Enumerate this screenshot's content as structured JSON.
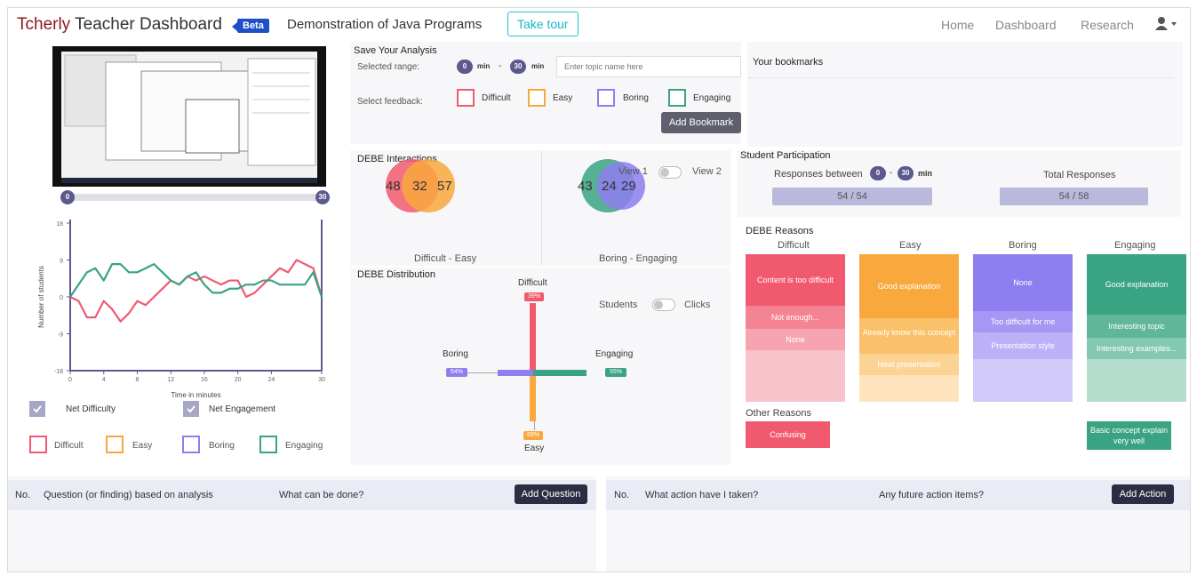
{
  "nav": {
    "brand_first": "Tcherly",
    "brand_rest": " Teacher Dashboard",
    "beta": "Beta",
    "session_title": "Demonstration of Java Programs",
    "tour": "Take tour",
    "links": [
      "Home",
      "Dashboard",
      "Research"
    ]
  },
  "video": {
    "range_start": "0",
    "range_end": "30"
  },
  "line_chart": {
    "ylabel": "Number of students",
    "xlabel": "Time in minutes",
    "y_ticks": [
      "18",
      "9",
      "0",
      "-9",
      "-18"
    ],
    "x_ticks": [
      "0",
      "4",
      "8",
      "12",
      "16",
      "20",
      "24",
      "30"
    ],
    "legend": [
      "Net Difficulty",
      "Net Engagement"
    ],
    "feedback_keys": [
      "Difficult",
      "Easy",
      "Boring",
      "Engaging"
    ]
  },
  "chart_data": {
    "type": "line",
    "xlabel": "Time in minutes",
    "ylabel": "Number of students",
    "xlim": [
      0,
      30
    ],
    "ylim": [
      -18,
      18
    ],
    "x": [
      0,
      1,
      2,
      3,
      4,
      5,
      6,
      7,
      8,
      9,
      10,
      11,
      12,
      13,
      14,
      15,
      16,
      17,
      18,
      19,
      20,
      21,
      22,
      23,
      24,
      25,
      26,
      27,
      28,
      29,
      30
    ],
    "series": [
      {
        "name": "Net Difficulty",
        "values": [
          0,
          -1,
          -5,
          -5,
          -1,
          -3,
          -6,
          -4,
          -1,
          -2,
          0,
          2,
          4,
          3,
          5,
          4,
          5,
          4,
          3,
          4,
          4,
          0,
          1,
          3,
          5,
          7,
          6,
          9,
          8,
          7,
          0
        ]
      },
      {
        "name": "Net Engagement",
        "values": [
          0,
          3,
          6,
          7,
          4,
          8,
          8,
          6,
          6,
          7,
          8,
          6,
          4,
          3,
          5,
          6,
          3,
          1,
          1,
          2,
          2,
          3,
          3,
          4,
          4,
          3,
          3,
          3,
          3,
          6,
          0
        ]
      }
    ]
  },
  "save_analysis": {
    "title": "Save Your Analysis",
    "range_label": "Selected range:",
    "start": "0",
    "start_unit": "min",
    "dash": "-",
    "end": "30",
    "end_unit": "min",
    "topic_placeholder": "Enter topic name here",
    "feedback_label": "Select feedback:",
    "options": [
      "Difficult",
      "Easy",
      "Boring",
      "Engaging"
    ],
    "button": "Add Bookmark"
  },
  "bookmarks": {
    "title": "Your bookmarks"
  },
  "interactions": {
    "title": "DEBE Interactions",
    "left_values": [
      "48",
      "32",
      "57"
    ],
    "left_label": "Difficult - Easy",
    "right_values": [
      "43",
      "24",
      "29"
    ],
    "right_label": "Boring - Engaging",
    "view1": "View 1",
    "view2": "View 2"
  },
  "distribution": {
    "title": "DEBE Distribution",
    "difficult": "Difficult",
    "difficult_pct": "39%",
    "easy": "Easy",
    "easy_pct": "69%",
    "boring": "Boring",
    "boring_pct": "54%",
    "engaging": "Engaging",
    "engaging_pct": "55%",
    "toggle_left": "Students",
    "toggle_right": "Clicks"
  },
  "participation": {
    "title": "Student Participation",
    "between_label": "Responses between",
    "start": "0",
    "dash": "-",
    "end": "30",
    "unit": "min",
    "between_value": "54 / 54",
    "total_label": "Total Responses",
    "total_value": "54 / 58"
  },
  "reasons": {
    "title": "DEBE Reasons",
    "columns": [
      {
        "label": "Difficult",
        "items": [
          "Content is too difficult",
          "Not enough...",
          "None"
        ]
      },
      {
        "label": "Easy",
        "items": [
          "Good explanation",
          "Already know this concept",
          "Neat presentation"
        ]
      },
      {
        "label": "Boring",
        "items": [
          "None",
          "Too difficult for me",
          "Presentation style"
        ]
      },
      {
        "label": "Engaging",
        "items": [
          "Good explanation",
          "Interesting topic",
          "Interesting examples..."
        ]
      }
    ],
    "other_title": "Other Reasons",
    "other_difficult": "Confusing",
    "other_engaging": "Basic concept explain very well"
  },
  "questions": {
    "no": "No.",
    "col1": "Question (or finding) based on analysis",
    "col2": "What can be done?",
    "button": "Add Question"
  },
  "actions": {
    "no": "No.",
    "col1": "What action have I taken?",
    "col2": "Any future action items?",
    "button": "Add Action"
  },
  "colors": {
    "difficult": "#f15a6e",
    "easy": "#f9a83e",
    "boring": "#8e7ef0",
    "engaging": "#3aa382",
    "accent": "#5c5a8c"
  }
}
